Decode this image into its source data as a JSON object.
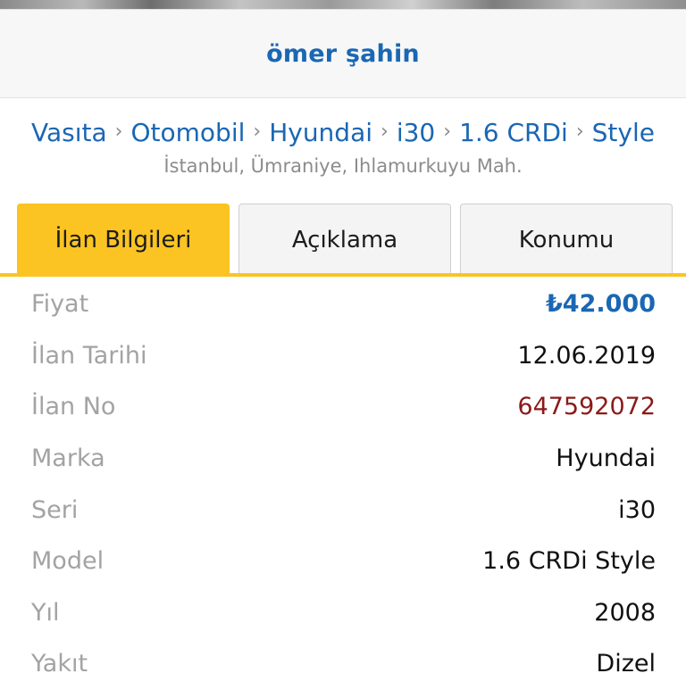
{
  "owner": {
    "name": "ömer şahin"
  },
  "breadcrumb": {
    "items": [
      "Vasıta",
      "Otomobil",
      "Hyundai",
      "i30",
      "1.6 CRDi",
      "Style"
    ],
    "separator": "›"
  },
  "location": "İstanbul, Ümraniye, Ihlamurkuyu Mah.",
  "tabs": [
    {
      "label": "İlan Bilgileri",
      "active": true
    },
    {
      "label": "Açıklama",
      "active": false
    },
    {
      "label": "Konumu",
      "active": false
    }
  ],
  "details": [
    {
      "label": "Fiyat",
      "value": "₺42.000"
    },
    {
      "label": "İlan Tarihi",
      "value": "12.06.2019"
    },
    {
      "label": "İlan No",
      "value": "647592072"
    },
    {
      "label": "Marka",
      "value": "Hyundai"
    },
    {
      "label": "Seri",
      "value": "i30"
    },
    {
      "label": "Model",
      "value": "1.6 CRDi Style"
    },
    {
      "label": "Yıl",
      "value": "2008"
    },
    {
      "label": "Yakıt",
      "value": "Dizel"
    }
  ],
  "colors": {
    "accent_yellow": "#fcc422",
    "link_blue": "#1a67b3",
    "ad_number_red": "#8b1a1a"
  }
}
